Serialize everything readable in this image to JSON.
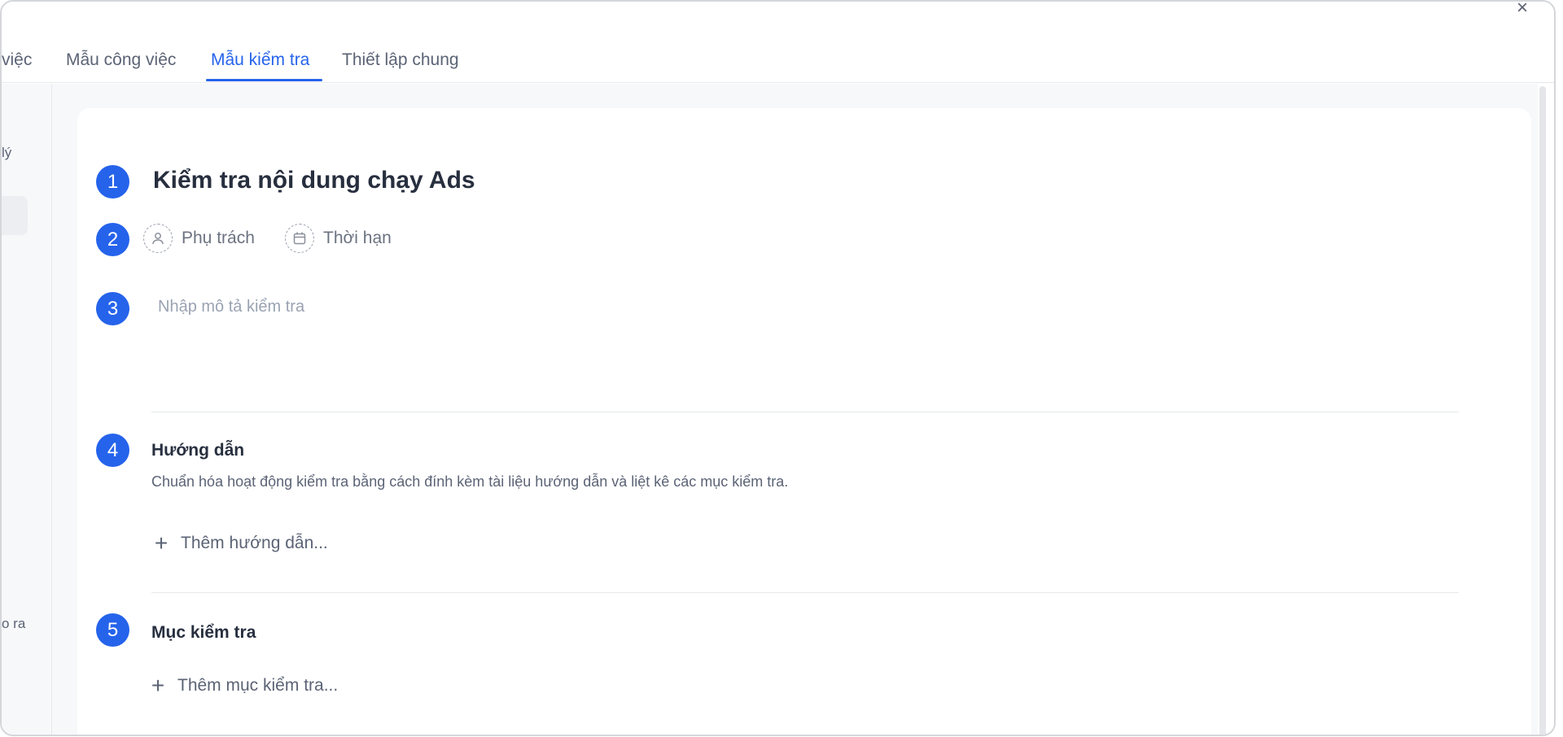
{
  "window": {
    "close_symbol": "×"
  },
  "tabs": [
    {
      "label": "việc",
      "active": false
    },
    {
      "label": "Mẫu công việc",
      "active": false
    },
    {
      "label": "Mẫu kiểm tra",
      "active": true
    },
    {
      "label": "Thiết lập chung",
      "active": false
    }
  ],
  "sidebar": {
    "text_top": "lý",
    "text_bottom": "o ra"
  },
  "form": {
    "steps": [
      "1",
      "2",
      "3",
      "4",
      "5"
    ],
    "title": "Kiểm tra nội dung chạy Ads",
    "assignee_label": "Phụ trách",
    "deadline_label": "Thời hạn",
    "description_placeholder": "Nhập mô tả kiểm tra",
    "guide": {
      "title": "Hướng dẫn",
      "description": "Chuẩn hóa hoạt động kiểm tra bằng cách đính kèm tài liệu hướng dẫn và liệt kê các mục kiểm tra.",
      "add_label": "Thêm hướng dẫn..."
    },
    "checklist": {
      "title": "Mục kiểm tra",
      "add_label": "Thêm mục kiểm tra..."
    }
  },
  "colors": {
    "accent": "#2563eb",
    "text": "#272f3f",
    "muted": "#5b6375"
  },
  "icons": {
    "close": "close-icon",
    "assignee": "user-icon",
    "deadline": "calendar-icon",
    "add": "plus-icon"
  }
}
